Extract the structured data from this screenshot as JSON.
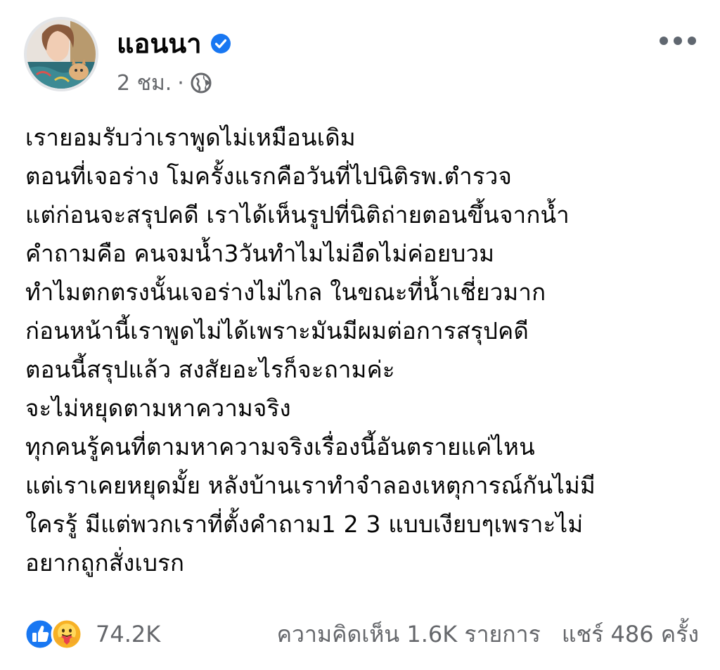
{
  "author": {
    "name": "แอนนา",
    "time": "2 ชม.",
    "separator": "·",
    "avatar_icon": "profile-photo",
    "verified_icon": "verified-badge-icon",
    "privacy_icon": "globe-icon"
  },
  "post": {
    "lines": [
      "เรายอมรับว่าเราพูดไม่เหมือนเดิม",
      "ตอนที่เจอร่าง โมครั้งแรกคือวันที่ไปนิติรพ.ตำรวจ",
      "แต่ก่อนจะสรุปคดี เราได้เห็นรูปที่นิติถ่ายตอนขึ้นจากน้ำ",
      "คำถามคือ คนจมน้ำ3วันทำไมไม่อืดไม่ค่อยบวม",
      "ทำไมตกตรงนั้นเจอร่างไม่ไกล ในขณะที่น้ำเชี่ยวมาก",
      "ก่อนหน้านี้เราพูดไม่ได้เพราะมันมีผมต่อการสรุปคดี",
      "ตอนนี้สรุปแล้ว สงสัยอะไรก็จะถามค่ะ",
      "จะไม่หยุดตามหาความจริง",
      "ทุกคนรู้คนที่ตามหาความจริงเรื่องนี้อันตรายแค่ไหน",
      "แต่เราเคยหยุดมั้ย หลังบ้านเราทำจำลองเหตุการณ์กันไม่มี",
      "ใครรู้ มีแต่พวกเราที่ตั้งคำถาม1 2 3 แบบเงียบๆเพราะไม่",
      "อยากถูกสั่งเบรก"
    ]
  },
  "footer": {
    "reaction_count": "74.2K",
    "comments": "ความคิดเห็น 1.6K รายการ",
    "shares": "แชร์ 486 ครั้ง",
    "reaction_icons": [
      "like-icon",
      "care-icon"
    ]
  },
  "colors": {
    "verified_blue": "#1877f2",
    "secondary_text": "#65676b",
    "like_blue": "#1877f2",
    "care_yellow": "#f7b125"
  }
}
